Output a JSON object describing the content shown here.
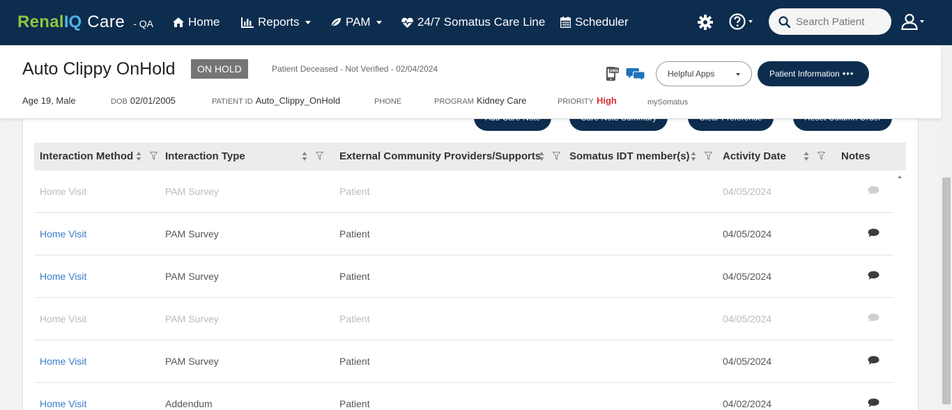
{
  "brand": {
    "part1": "Renal",
    "part2": "IQ",
    "part3": "Care",
    "env": "- QA"
  },
  "nav": {
    "home": "Home",
    "reports": "Reports",
    "pam": "PAM",
    "care_line": "24/7 Somatus Care Line",
    "scheduler": "Scheduler"
  },
  "search": {
    "placeholder": "Search Patient"
  },
  "patient": {
    "name": "Auto Clippy OnHold",
    "status": "ON HOLD",
    "deceased_note": "Patient Deceased - Not Verified - 02/04/2024",
    "age_sex": "Age 19, Male",
    "dob_label": "DOB",
    "dob": "02/01/2005",
    "pid_label": "PATIENT ID",
    "pid": "Auto_Clippy_OnHold",
    "phone_label": "PHONE",
    "phone": "",
    "program_label": "PROGRAM",
    "program": "Kidney Care",
    "priority_label": "PRIORITY",
    "priority": "High",
    "mysomatus": "mySomatus"
  },
  "actions": {
    "helpful_apps": "Helpful Apps",
    "patient_info": "Patient Information",
    "patient_info_dots": "•••"
  },
  "toolbar": {
    "add_care_note": "Add Care Note",
    "care_note_summary": "Care Note Summary",
    "clear_preference": "Clear Preference",
    "reset_column_order": "Reset Column Order"
  },
  "table": {
    "columns": [
      "Interaction Method",
      "Interaction Type",
      "External Community Providers/Supports",
      "Somatus IDT member(s)",
      "Activity Date",
      "Notes"
    ],
    "rows": [
      {
        "method": "Home Visit",
        "type": "PAM Survey",
        "external": "Patient",
        "idt": "",
        "date": "04/05/2024",
        "muted": true
      },
      {
        "method": "Home Visit",
        "type": "PAM Survey",
        "external": "Patient",
        "idt": "",
        "date": "04/05/2024",
        "muted": false
      },
      {
        "method": "Home Visit",
        "type": "PAM Survey",
        "external": "Patient",
        "idt": "",
        "date": "04/05/2024",
        "muted": false
      },
      {
        "method": "Home Visit",
        "type": "PAM Survey",
        "external": "Patient",
        "idt": "",
        "date": "04/05/2024",
        "muted": true
      },
      {
        "method": "Home Visit",
        "type": "PAM Survey",
        "external": "Patient",
        "idt": "",
        "date": "04/05/2024",
        "muted": false
      },
      {
        "method": "Home Visit",
        "type": "Addendum",
        "external": "Patient",
        "idt": "",
        "date": "04/02/2024",
        "muted": false
      }
    ]
  },
  "colors": {
    "navy": "#0d2d4f",
    "green": "#8dc63f",
    "blue": "#4fb3e6",
    "link": "#3a7dc9",
    "high": "#d32f2f"
  }
}
